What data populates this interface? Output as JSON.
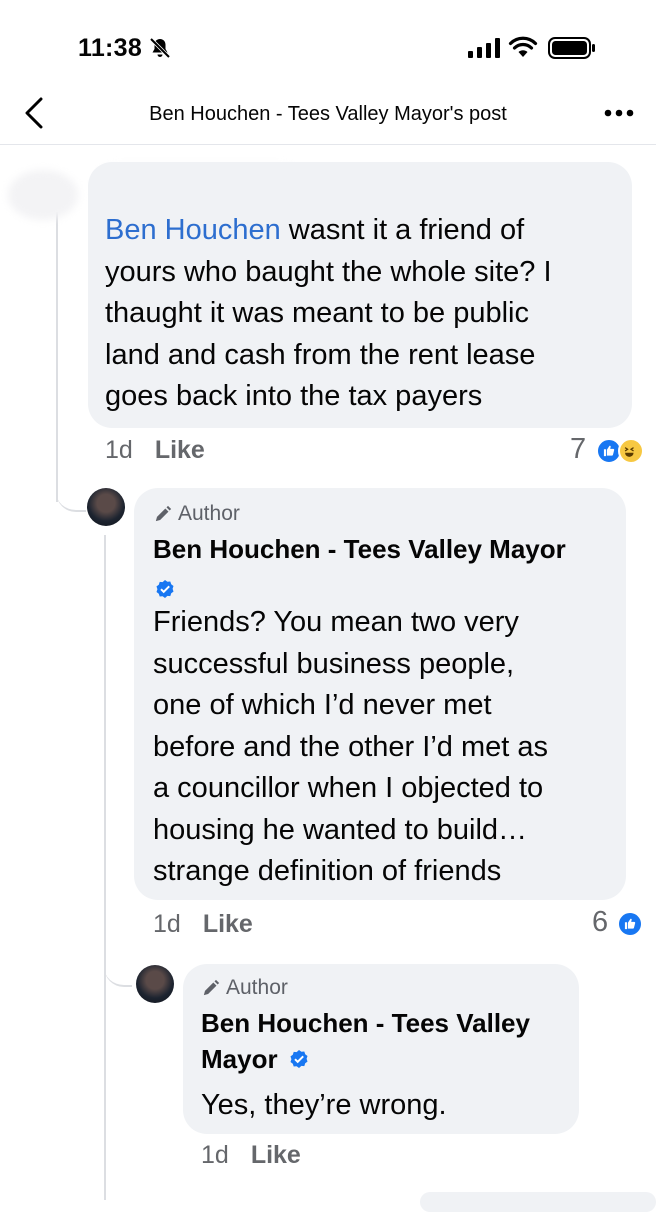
{
  "status_bar": {
    "time": "11:38"
  },
  "header": {
    "title": "Ben Houchen - Tees Valley Mayor's post"
  },
  "comments": [
    {
      "mention": "Ben Houchen",
      "lines": [
        " wasnt it a friend of",
        "yours who baught the whole site? I",
        "thaught it was meant to be public",
        "land and cash from the rent lease",
        "goes back into the tax payers"
      ],
      "time": "1d",
      "like_label": "Like",
      "reaction_count": "7"
    },
    {
      "author_label": "Author",
      "author_name": "Ben Houchen - Tees Valley Mayor",
      "lines": [
        "Friends? You mean two very",
        "successful business people,",
        "one of which I’d never met",
        "before and the other I’d met as",
        "a councillor when I objected to",
        "housing he wanted to build…",
        "strange definition of friends"
      ],
      "time": "1d",
      "like_label": "Like",
      "reaction_count": "6"
    },
    {
      "author_label": "Author",
      "author_name_line1": "Ben Houchen - Tees Valley",
      "author_name_line2": "Mayor",
      "text": "Yes, they’re wrong.",
      "time": "1d",
      "like_label": "Like"
    }
  ],
  "icons": {
    "back": "chevron-left-icon",
    "more": "more-icon",
    "verified": "verified-badge-icon",
    "author": "pencil-icon",
    "reaction_like": "like-reaction-icon",
    "reaction_haha": "haha-reaction-icon"
  },
  "colors": {
    "mention": "#2d6ecf",
    "bubble": "#f0f2f5",
    "verified": "#1877f2"
  }
}
